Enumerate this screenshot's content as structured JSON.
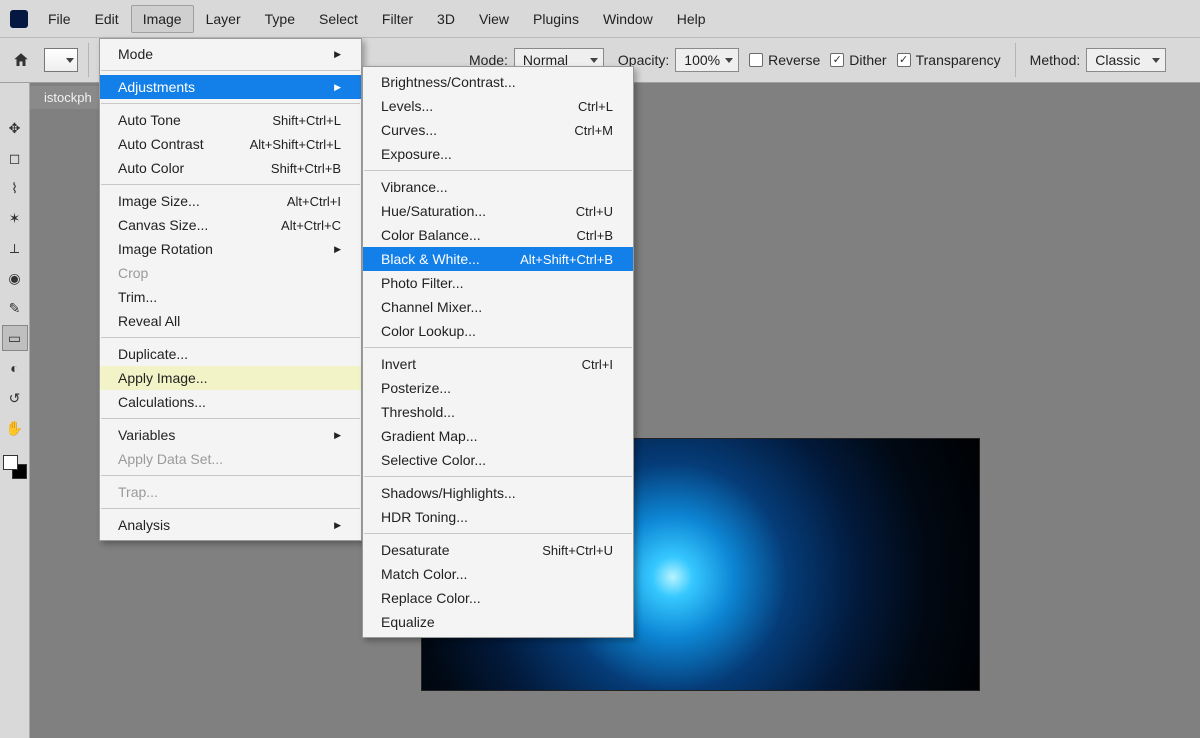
{
  "menubar": {
    "items": [
      "File",
      "Edit",
      "Image",
      "Layer",
      "Type",
      "Select",
      "Filter",
      "3D",
      "View",
      "Plugins",
      "Window",
      "Help"
    ],
    "activeIndex": 2
  },
  "optionsbar": {
    "mode_label": "Mode:",
    "mode_value": "Normal",
    "opacity_label": "Opacity:",
    "opacity_value": "100%",
    "reverse_label": "Reverse",
    "reverse_checked": false,
    "dither_label": "Dither",
    "dither_checked": true,
    "transparency_label": "Transparency",
    "transparency_checked": true,
    "method_label": "Method:",
    "method_value": "Classic"
  },
  "document_tab": "istockph",
  "image_menu": [
    {
      "label": "Mode",
      "arrow": true
    },
    {
      "sep": true
    },
    {
      "label": "Adjustments",
      "arrow": true,
      "hl": true
    },
    {
      "sep": true
    },
    {
      "label": "Auto Tone",
      "short": "Shift+Ctrl+L"
    },
    {
      "label": "Auto Contrast",
      "short": "Alt+Shift+Ctrl+L"
    },
    {
      "label": "Auto Color",
      "short": "Shift+Ctrl+B"
    },
    {
      "sep": true
    },
    {
      "label": "Image Size...",
      "short": "Alt+Ctrl+I"
    },
    {
      "label": "Canvas Size...",
      "short": "Alt+Ctrl+C"
    },
    {
      "label": "Image Rotation",
      "arrow": true
    },
    {
      "label": "Crop",
      "dis": true
    },
    {
      "label": "Trim..."
    },
    {
      "label": "Reveal All"
    },
    {
      "sep": true
    },
    {
      "label": "Duplicate..."
    },
    {
      "label": "Apply Image...",
      "highlighted": true
    },
    {
      "label": "Calculations..."
    },
    {
      "sep": true
    },
    {
      "label": "Variables",
      "arrow": true
    },
    {
      "label": "Apply Data Set...",
      "dis": true
    },
    {
      "sep": true
    },
    {
      "label": "Trap...",
      "dis": true
    },
    {
      "sep": true
    },
    {
      "label": "Analysis",
      "arrow": true
    }
  ],
  "adjust_menu": [
    {
      "label": "Brightness/Contrast..."
    },
    {
      "label": "Levels...",
      "short": "Ctrl+L"
    },
    {
      "label": "Curves...",
      "short": "Ctrl+M"
    },
    {
      "label": "Exposure..."
    },
    {
      "sep": true
    },
    {
      "label": "Vibrance..."
    },
    {
      "label": "Hue/Saturation...",
      "short": "Ctrl+U"
    },
    {
      "label": "Color Balance...",
      "short": "Ctrl+B"
    },
    {
      "label": "Black & White...",
      "short": "Alt+Shift+Ctrl+B",
      "hl": true
    },
    {
      "label": "Photo Filter..."
    },
    {
      "label": "Channel Mixer..."
    },
    {
      "label": "Color Lookup..."
    },
    {
      "sep": true
    },
    {
      "label": "Invert",
      "short": "Ctrl+I"
    },
    {
      "label": "Posterize..."
    },
    {
      "label": "Threshold..."
    },
    {
      "label": "Gradient Map..."
    },
    {
      "label": "Selective Color..."
    },
    {
      "sep": true
    },
    {
      "label": "Shadows/Highlights..."
    },
    {
      "label": "HDR Toning..."
    },
    {
      "sep": true
    },
    {
      "label": "Desaturate",
      "short": "Shift+Ctrl+U"
    },
    {
      "label": "Match Color..."
    },
    {
      "label": "Replace Color..."
    },
    {
      "label": "Equalize"
    }
  ],
  "tools": [
    {
      "name": "move-tool",
      "glyph": "✥"
    },
    {
      "name": "marquee-tool",
      "glyph": "◻"
    },
    {
      "name": "lasso-tool",
      "glyph": "⌇"
    },
    {
      "name": "wand-tool",
      "glyph": "✶"
    },
    {
      "name": "crop-tool",
      "glyph": "⟂"
    },
    {
      "name": "eyedropper-tool",
      "glyph": "◉"
    },
    {
      "name": "brush-tool",
      "glyph": "✎"
    },
    {
      "name": "gradient-tool",
      "glyph": "▭",
      "sel": true
    },
    {
      "name": "dodge-tool",
      "glyph": "◐"
    },
    {
      "name": "path-tool",
      "glyph": "↺"
    },
    {
      "name": "hand-tool",
      "glyph": "✋"
    }
  ]
}
